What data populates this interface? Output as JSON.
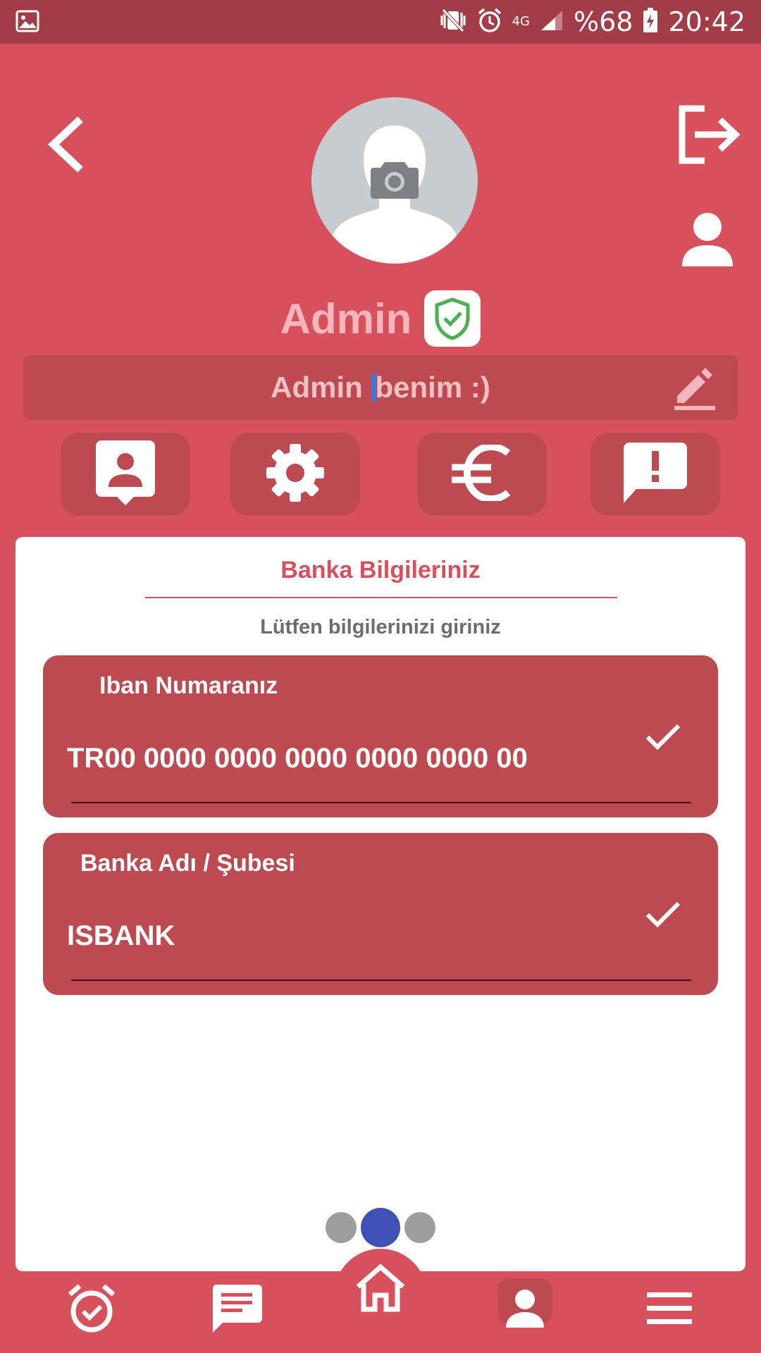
{
  "status_bar": {
    "battery": "%68",
    "time": "20:42",
    "network": "4G"
  },
  "profile": {
    "name": "Admin",
    "bio_before_caret": "Admin ",
    "bio_after_caret": "benim :)"
  },
  "card": {
    "title": "Banka Bilgileriniz",
    "subtitle": "Lütfen bilgilerinizi giriniz",
    "fields": [
      {
        "label": "Iban Numaranız",
        "value": "TR00 0000 0000 0000 0000 0000 00"
      },
      {
        "label": "Banka Adı / Şubesi",
        "value": "ISBANK"
      }
    ]
  },
  "pager": {
    "count": 3,
    "active_index": 1
  },
  "colors": {
    "primary": "#d9505d",
    "dark": "#bd4a51",
    "status_bar": "#a33c47",
    "pager_active": "#3f51b5"
  },
  "icons": {
    "tiles": [
      "contact-card-icon",
      "settings-gear-icon",
      "euro-icon",
      "feedback-alert-icon"
    ],
    "bottom_nav": [
      "alarm-icon",
      "chat-icon",
      "home-icon",
      "person-icon",
      "menu-icon"
    ]
  }
}
